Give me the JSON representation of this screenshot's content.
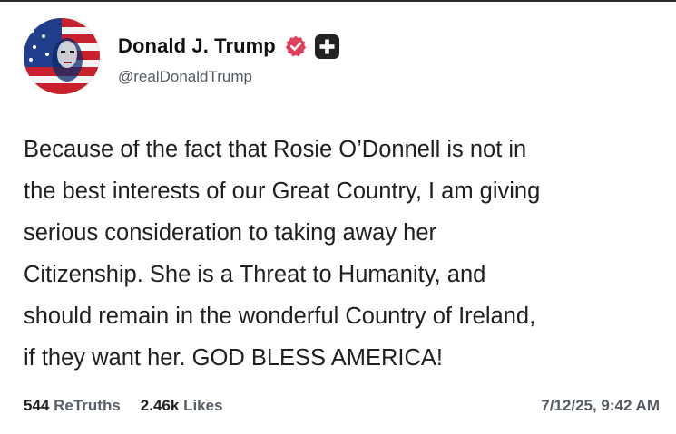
{
  "author": {
    "display_name": "Donald J. Trump",
    "handle": "@realDonaldTrump",
    "verified_icon": "verified-badge-icon",
    "extra_badge_icon": "plus-badge-icon"
  },
  "post": {
    "text": "Because of the fact that Rosie O’Donnell is not in\nthe best interests of our Great Country, I am giving\nserious consideration to taking away her\nCitizenship. She is a Threat to Humanity, and\nshould remain in the wonderful Country of Ireland,\nif they want her. GOD BLESS AMERICA!"
  },
  "stats": {
    "retruths_count": "544",
    "retruths_label": "ReTruths",
    "likes_count": "2.46k",
    "likes_label": "Likes",
    "timestamp": "7/12/25, 9:42 AM"
  },
  "colors": {
    "verified_badge": "#e0405c",
    "plus_badge": "#222222",
    "text": "#1e1f22",
    "muted": "#555b63"
  }
}
